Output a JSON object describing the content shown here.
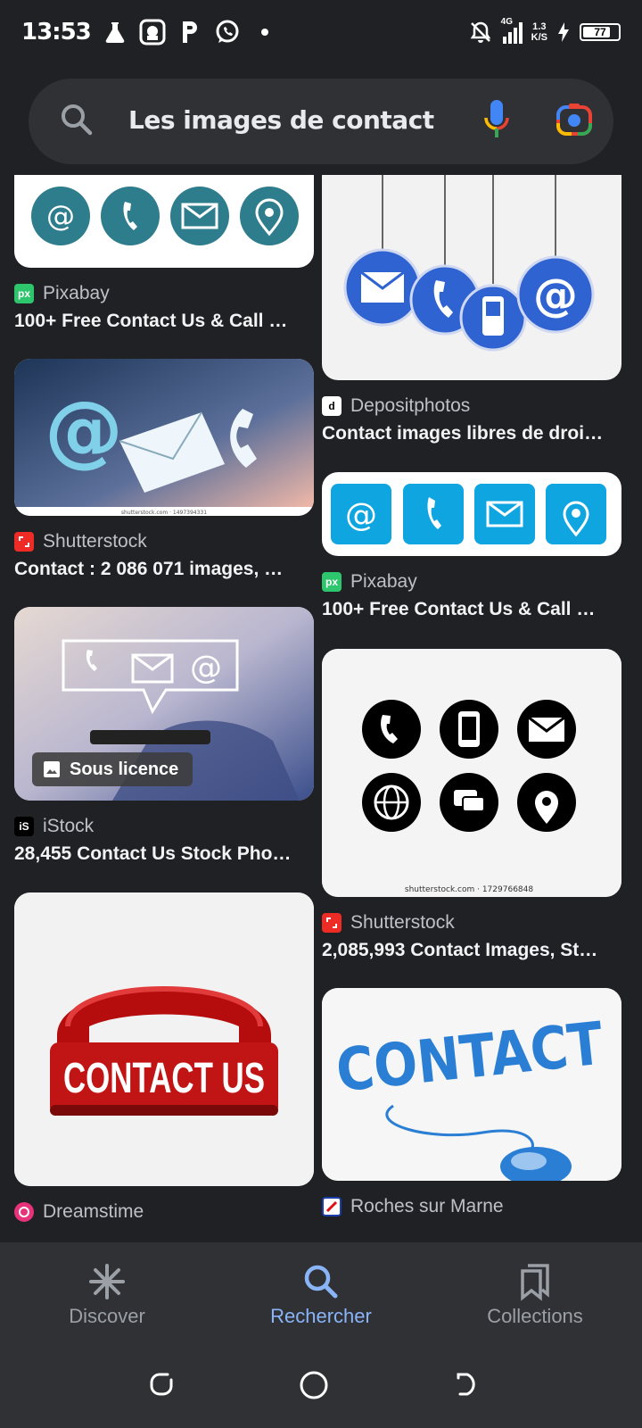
{
  "status_bar": {
    "time": "13:53",
    "network_type": "4G",
    "speed_value": "1.3",
    "speed_unit": "K/S",
    "battery": "77"
  },
  "search": {
    "query": "Les images de contact"
  },
  "colors": {
    "background": "#202124",
    "surface": "#303134",
    "accent": "#8ab4f8"
  },
  "results": [
    {
      "source": "Pixabay",
      "title": "100+ Free Contact Us & Call …",
      "favicon_text": "px"
    },
    {
      "source": "Depositphotos",
      "title": "Contact images libres de droi…",
      "favicon_text": "d"
    },
    {
      "source": "Shutterstock",
      "title": "Contact : 2 086 071 images, …",
      "watermark": "shutterstock.com · 1497394331"
    },
    {
      "source": "Pixabay",
      "title": "100+ Free Contact Us & Call …",
      "favicon_text": "px"
    },
    {
      "source": "iStock",
      "title": "28,455 Contact Us Stock Pho…",
      "badge": "Sous licence",
      "favicon_text": "iS"
    },
    {
      "source": "Shutterstock",
      "title": "2,085,993 Contact Images, St…",
      "watermark": "shutterstock.com · 1729766848"
    },
    {
      "source": "Dreamstime",
      "title": "",
      "image_text": "CONTACT US"
    },
    {
      "source": "Roches sur Marne",
      "title": "",
      "image_text": "CONTACT"
    }
  ],
  "bottom_nav": {
    "discover": "Discover",
    "search": "Rechercher",
    "collections": "Collections"
  }
}
